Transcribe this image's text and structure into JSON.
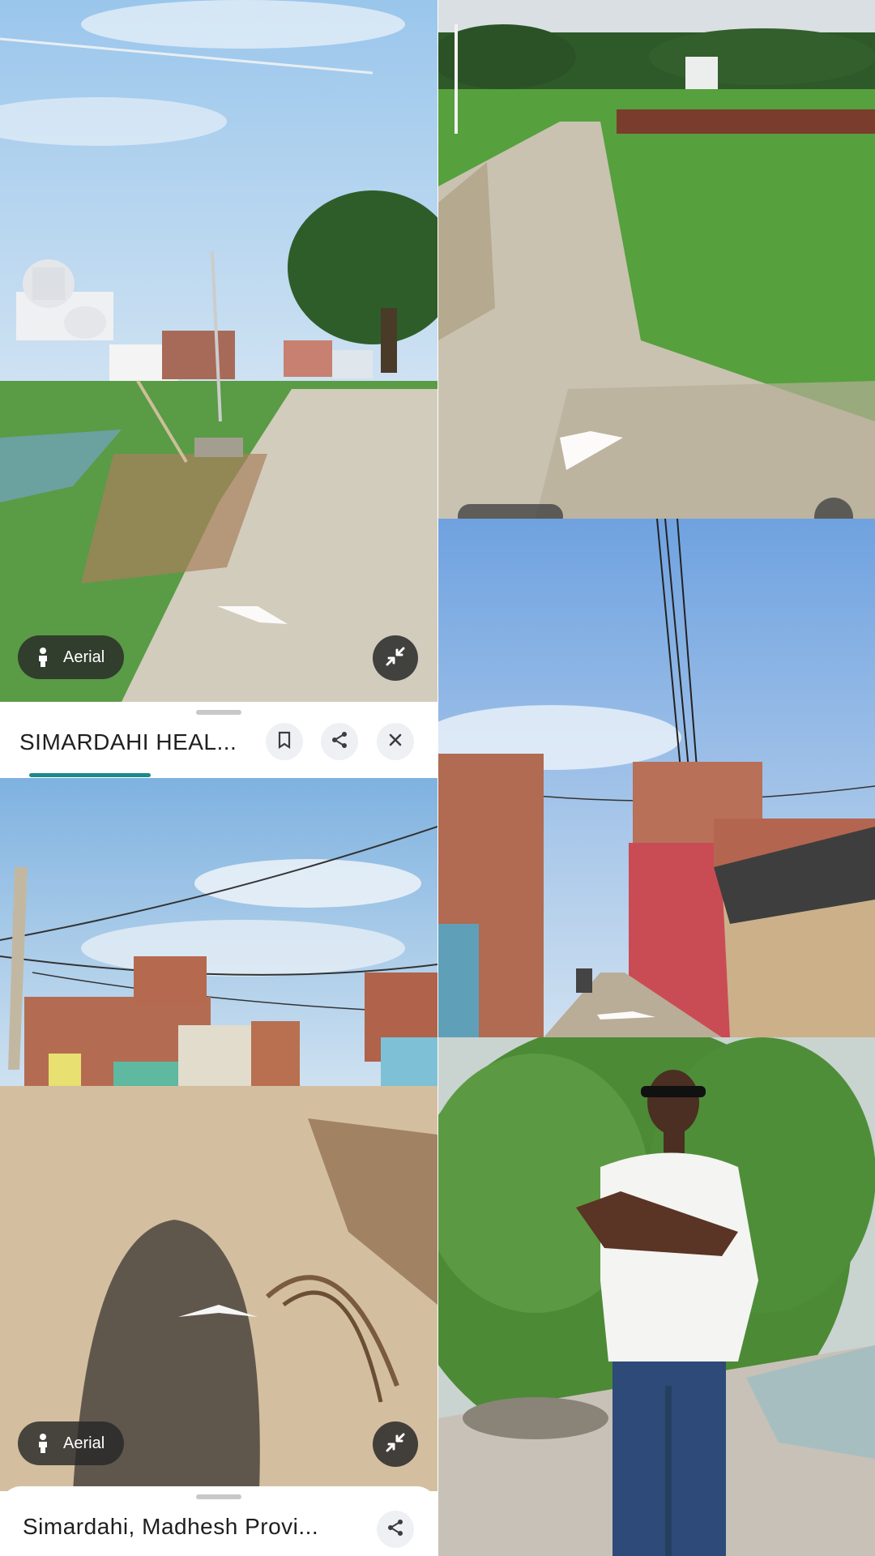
{
  "panels": {
    "top_left": {
      "chip_label": "Aerial",
      "sheet_title": "SIMARDAHI HEAL...",
      "icons": [
        "person-icon",
        "collapse-icon",
        "bookmark-icon",
        "share-icon",
        "close-icon"
      ]
    },
    "bottom_left": {
      "chip_label": "Aerial",
      "sheet_title": "Simardahi, Madhesh Provi...",
      "icons": [
        "person-icon",
        "collapse-icon",
        "share-icon"
      ]
    }
  },
  "colors": {
    "sky": "#8fc0e8",
    "grass": "#4f9a3a",
    "road": "#cfc8b8",
    "brick": "#b0664a",
    "chip_bg": "#2e2e2e",
    "sheet_bg": "#ffffff",
    "accent": "#1a8a8a"
  }
}
